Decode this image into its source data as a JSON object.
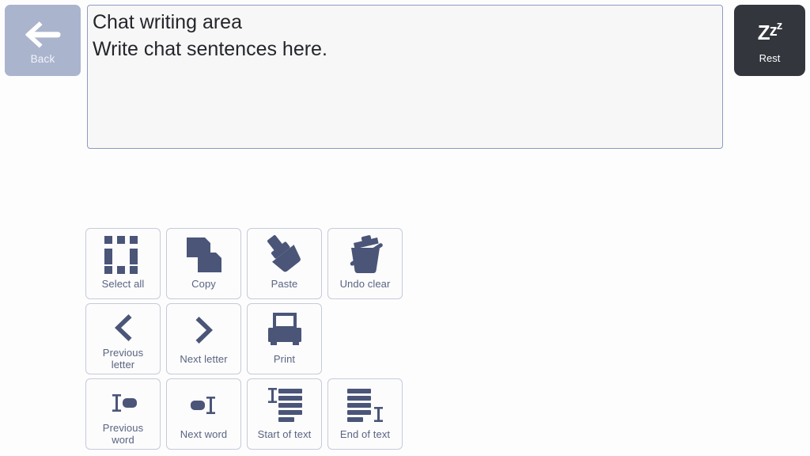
{
  "app": {
    "background_color": "#fdfdfd",
    "icon_color": "#4a5578",
    "label_color": "#5a6480"
  },
  "back_button": {
    "label": "Back",
    "icon": "arrow-left-icon",
    "background_color": "#aab4cd"
  },
  "rest_button": {
    "label": "Rest",
    "icon": "zzz-sleep-icon",
    "zzz": {
      "z1": "Z",
      "z2": "z",
      "z3": "z"
    },
    "background_color": "#33363d"
  },
  "chat_area": {
    "name": "chat-writing-area",
    "lines": [
      "Chat writing area",
      "Write chat sentences here."
    ],
    "border_color": "#8c9cc0",
    "background_color": "#f7f7f8"
  },
  "commands": {
    "rows": [
      [
        {
          "label": "Select all",
          "icon": "select-all-icon",
          "lines": 1
        },
        {
          "label": "Copy",
          "icon": "copy-icon",
          "lines": 1
        },
        {
          "label": "Paste",
          "icon": "paste-icon",
          "lines": 1
        },
        {
          "label": "Undo clear",
          "icon": "undo-clear-trash-icon",
          "lines": 1
        }
      ],
      [
        {
          "label": "Previous letter",
          "label_line1": "Previous",
          "label_line2": "letter",
          "icon": "chevron-left-icon",
          "lines": 2
        },
        {
          "label": "Next letter",
          "icon": "chevron-right-icon",
          "lines": 1
        },
        {
          "label": "Print",
          "icon": "printer-icon",
          "lines": 1
        }
      ],
      [
        {
          "label": "Previous word",
          "label_line1": "Previous",
          "label_line2": "word",
          "icon": "previous-word-icon",
          "lines": 2
        },
        {
          "label": "Next word",
          "icon": "next-word-icon",
          "lines": 1
        },
        {
          "label": "Start of text",
          "icon": "start-of-text-icon",
          "lines": 1
        },
        {
          "label": "End of text",
          "icon": "end-of-text-icon",
          "lines": 1
        }
      ]
    ]
  }
}
